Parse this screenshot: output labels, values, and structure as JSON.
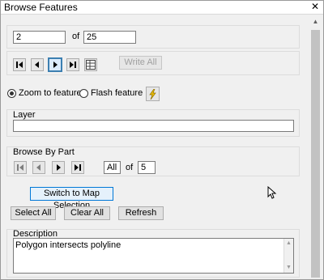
{
  "window": {
    "title": "Browse Features",
    "close_glyph": "✕"
  },
  "feature_nav": {
    "current": "2",
    "of_label": "of",
    "total": "25"
  },
  "toolbar": {
    "write_all_label": "Write All"
  },
  "zoom_options": {
    "zoom_label": "Zoom to feature",
    "zoom_selected": true,
    "flash_label": "Flash feature",
    "flash_icon": "lightning-icon"
  },
  "layer": {
    "label": "Layer",
    "value": ""
  },
  "browse_by_part": {
    "label": "Browse By Part",
    "current": "All",
    "of_label": "of",
    "total": "5"
  },
  "actions": {
    "switch_label": "Switch to Map Selection",
    "select_all_label": "Select All",
    "clear_all_label": "Clear All",
    "refresh_label": "Refresh"
  },
  "description": {
    "label": "Description",
    "text": "Polygon intersects polyline"
  },
  "colors": {
    "accent": "#0078d7",
    "selected_border": "#3c7fb1"
  }
}
